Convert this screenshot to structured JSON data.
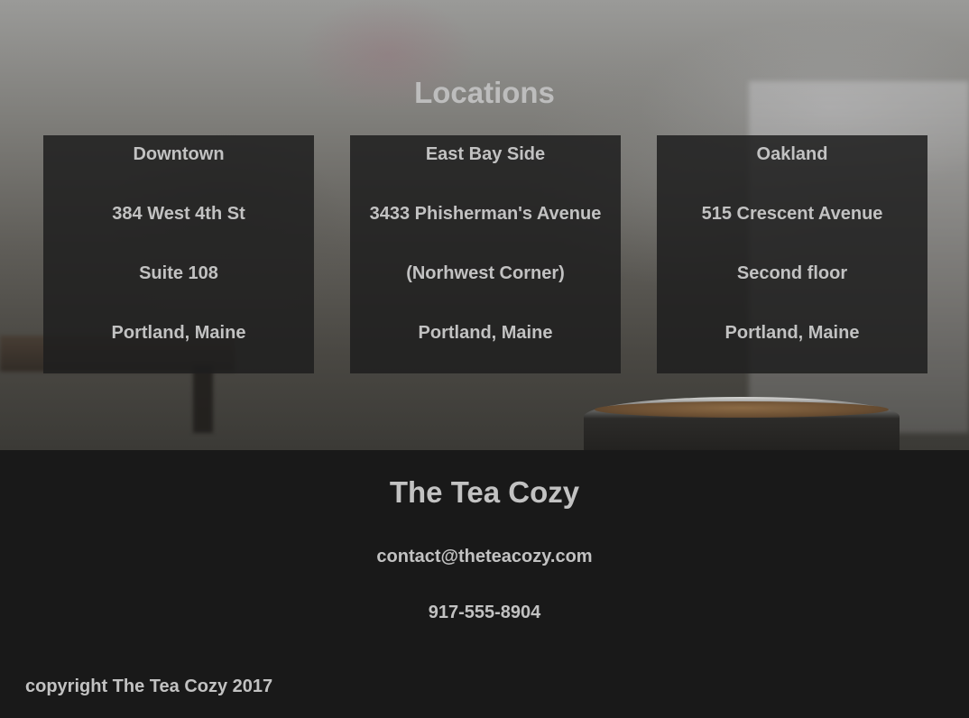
{
  "locations_section": {
    "title": "Locations",
    "items": [
      {
        "name": "Downtown",
        "address_line1": "384 West 4th St",
        "address_line2": "Suite 108",
        "city": "Portland, Maine"
      },
      {
        "name": "East Bay Side",
        "address_line1": "3433 Phisherman's Avenue",
        "address_line2": "(Norhwest Corner)",
        "city": "Portland, Maine"
      },
      {
        "name": "Oakland",
        "address_line1": "515 Crescent Avenue",
        "address_line2": "Second floor",
        "city": "Portland, Maine"
      }
    ]
  },
  "footer": {
    "brand": "The Tea Cozy",
    "email": "contact@theteacozy.com",
    "phone": "917-555-8904",
    "copyright": "copyright The Tea Cozy 2017"
  },
  "colors": {
    "footer_background": "#191919",
    "text": "#c2c2c2",
    "card_background": "#1e1e1e"
  }
}
